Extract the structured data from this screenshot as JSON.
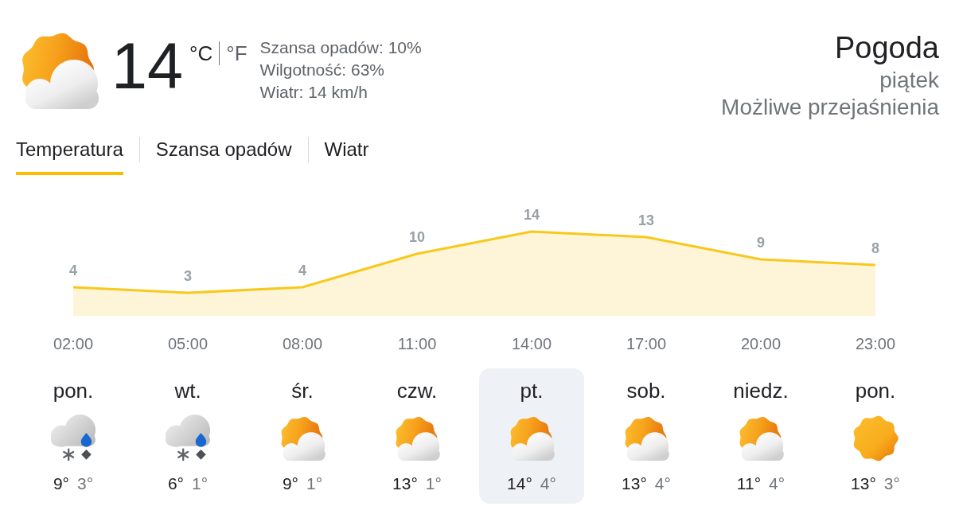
{
  "current": {
    "kind": "partly_cloudy",
    "temperature": "14",
    "units": [
      {
        "label": "°C",
        "selected": true
      },
      {
        "label": "°F",
        "selected": false
      }
    ],
    "details": [
      "Szansa opadów: 10%",
      "Wilgotność: 63%",
      "Wiatr: 14 km/h"
    ]
  },
  "location": {
    "title": "Pogoda",
    "day": "piątek",
    "condition": "Możliwe przejaśnienia"
  },
  "tabs": [
    {
      "label": "Temperatura",
      "selected": true
    },
    {
      "label": "Szansa opadów",
      "selected": false
    },
    {
      "label": "Wiatr",
      "selected": false
    }
  ],
  "chart": {
    "chart_data": {
      "type": "area",
      "categories": [
        "02:00",
        "05:00",
        "08:00",
        "11:00",
        "14:00",
        "17:00",
        "20:00",
        "23:00"
      ],
      "values": [
        4,
        3,
        4,
        10,
        14,
        13,
        9,
        8
      ],
      "data_labels": true
    }
  },
  "days": [
    {
      "name": "pon.",
      "kind": "snow_rain",
      "high": "9°",
      "low": "3°",
      "selected": false
    },
    {
      "name": "wt.",
      "kind": "snow_rain",
      "high": "6°",
      "low": "1°",
      "selected": false
    },
    {
      "name": "śr.",
      "kind": "partly_cloudy",
      "high": "9°",
      "low": "1°",
      "selected": false
    },
    {
      "name": "czw.",
      "kind": "partly_cloudy",
      "high": "13°",
      "low": "1°",
      "selected": false
    },
    {
      "name": "pt.",
      "kind": "partly_cloudy",
      "high": "14°",
      "low": "4°",
      "selected": true
    },
    {
      "name": "sob.",
      "kind": "partly_cloudy",
      "high": "13°",
      "low": "4°",
      "selected": false
    },
    {
      "name": "niedz.",
      "kind": "partly_cloudy",
      "high": "11°",
      "low": "4°",
      "selected": false
    },
    {
      "name": "pon.",
      "kind": "sunny",
      "high": "13°",
      "low": "3°",
      "selected": false
    }
  ]
}
